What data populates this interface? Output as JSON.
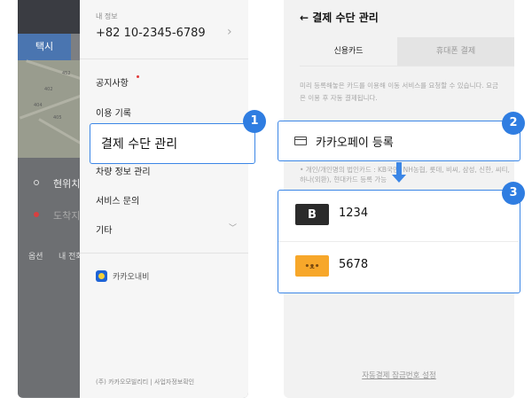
{
  "left_screen": {
    "map": {
      "taxi_tab": "택시",
      "map_labels": [
        "452",
        "402",
        "404",
        "405"
      ],
      "origin_label": "현위치",
      "destination_label": "도착지",
      "options_label": "옵션",
      "my_route_label": "내 전화"
    },
    "drawer": {
      "info_label": "내 정보",
      "phone_number": "+82 10-2345-6789",
      "menu": {
        "notice": "공지사항",
        "usage_history": "이용 기록",
        "vehicle_info": "차량 정보 관리",
        "service_inquiry": "서비스 문의",
        "etc": "기타"
      },
      "kakaonavi": "카카오내비",
      "footer": "(주) 카카오모빌리티 | 사업자정보확인"
    },
    "highlight": {
      "label": "결제 수단 관리",
      "step": "1"
    }
  },
  "right_screen": {
    "title": "← 결제 수단 관리",
    "tabs": {
      "credit_card": "신용카드",
      "phone_payment": "휴대폰 결제"
    },
    "description": "미리 등록해놓은 카드를 이용해 이동 서비스를 요청할 수 있습니다. 요금은 이용 후 자동 결제됩니다.",
    "register": {
      "label": "카카오페이 등록",
      "step": "2"
    },
    "notice": "• 개인/개인명의 법인카드 : KB국민, NH농협, 롯데, 비씨, 삼성, 신한, 씨티, 하나(외환), 현대카드 등록 가능",
    "cards": {
      "step": "3",
      "items": [
        {
          "logo_text": "B",
          "number": "1234",
          "logo_color": "#2b2b2b"
        },
        {
          "logo_text": "•ᴥ•",
          "number": "5678",
          "logo_color": "#f7a72a"
        }
      ]
    },
    "bottom_link": "자동결제 잠금번호 설정"
  },
  "colors": {
    "accent": "#2f7de1",
    "outline": "#3b86e6",
    "taxi_tab": "#4a75b0"
  }
}
